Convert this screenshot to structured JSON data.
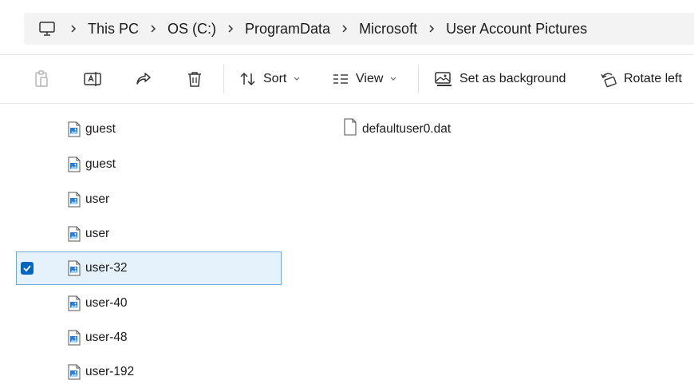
{
  "breadcrumb": {
    "items": [
      "This PC",
      "OS (C:)",
      "ProgramData",
      "Microsoft",
      "User Account Pictures"
    ]
  },
  "toolbar": {
    "sort_label": "Sort",
    "view_label": "View",
    "set_background_label": "Set as background",
    "rotate_left_label": "Rotate left"
  },
  "files": [
    {
      "name": "guest",
      "selected": false
    },
    {
      "name": "guest",
      "selected": false
    },
    {
      "name": "user",
      "selected": false
    },
    {
      "name": "user",
      "selected": false
    },
    {
      "name": "user-32",
      "selected": true
    },
    {
      "name": "user-40",
      "selected": false
    },
    {
      "name": "user-48",
      "selected": false
    },
    {
      "name": "user-192",
      "selected": false
    }
  ],
  "other_file": {
    "name": "defaultuser0.dat"
  },
  "colors": {
    "accent": "#0067c0",
    "selection_bg": "#e5f1fb",
    "selection_border": "#6fa9d6"
  }
}
